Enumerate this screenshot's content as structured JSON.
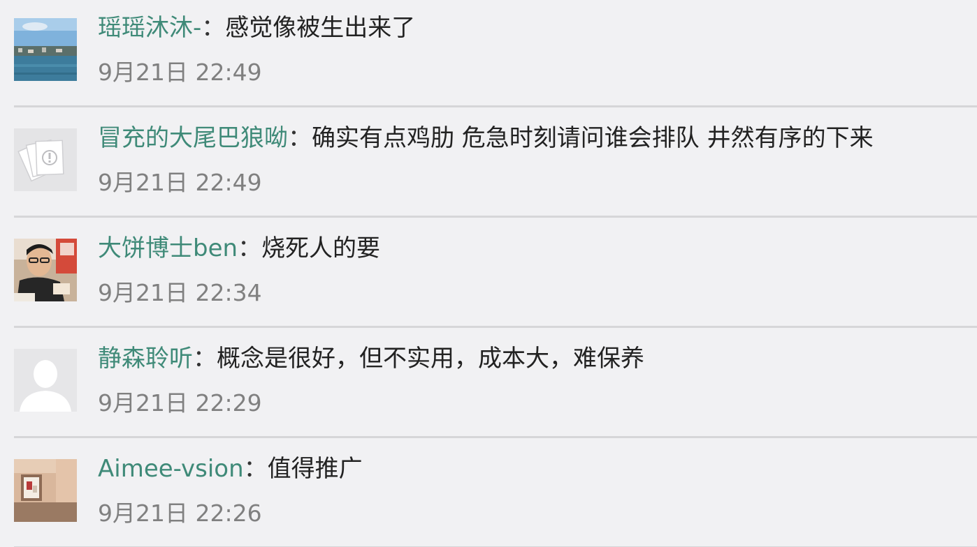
{
  "comments": [
    {
      "user": "瑶瑶沐沐-",
      "sep": "：",
      "text": "感觉像被生出来了",
      "time": "9月21日 22:49",
      "avatar": "landscape-photo-avatar"
    },
    {
      "user": "冒充的大尾巴狼呦",
      "sep": "：",
      "text": "确实有点鸡肋  危急时刻请问谁会排队   井然有序的下来",
      "time": "9月21日 22:49",
      "avatar": "cards-placeholder-avatar"
    },
    {
      "user": "大饼博士ben",
      "sep": "：",
      "text": "烧死人的要",
      "time": "9月21日 22:34",
      "avatar": "person-photo-avatar"
    },
    {
      "user": "静森聆听",
      "sep": "：",
      "text": "概念是很好，但不实用，成本大，难保养",
      "time": "9月21日 22:29",
      "avatar": "default-user-avatar"
    },
    {
      "user": "Aimee-vsion",
      "sep": "：",
      "text": "值得推广",
      "time": "9月21日 22:26",
      "avatar": "room-photo-avatar"
    }
  ],
  "colors": {
    "username": "#3f8a78",
    "time": "#808080",
    "background": "#f1f1f3",
    "divider": "#d6d6d8"
  }
}
